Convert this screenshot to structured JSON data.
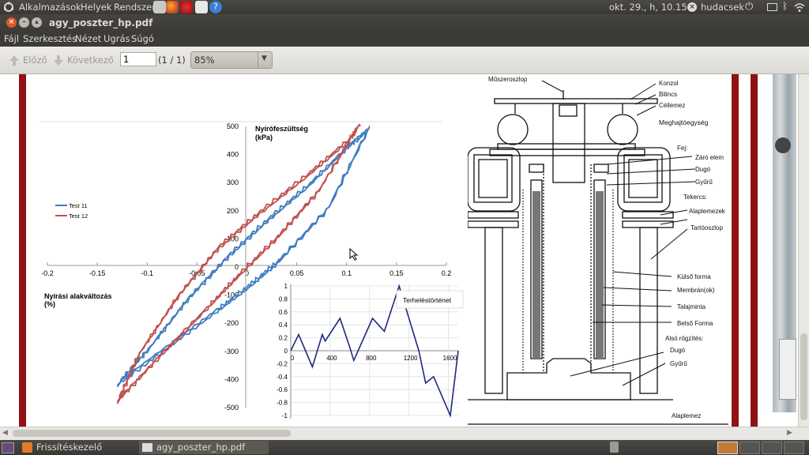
{
  "top_panel": {
    "menu_applications": "Alkalmazások",
    "menu_places": "Helyek",
    "menu_system": "Rendszer",
    "clock": "okt. 29., h, 10.15",
    "user": "hudacsek"
  },
  "window": {
    "title": "agy_poszter_hp.pdf"
  },
  "menubar": {
    "file": "Fájl",
    "edit": "Szerkesztés",
    "view": "Nézet",
    "go": "Ugrás",
    "help": "Súgó"
  },
  "toolbar": {
    "prev_label": "Előző",
    "next_label": "Következő",
    "page_value": "1",
    "page_count": "(1 / 1)",
    "zoom_value": "85%"
  },
  "document": {
    "hyst_ylabel_1": "Nyírófeszültség",
    "hyst_ylabel_2": "(kPa)",
    "hyst_xlabel_1": "Nyírási alakváltozás",
    "hyst_xlabel_2": "(%)",
    "legend_1": "Test 11",
    "legend_2": "Test 12",
    "hyst_yticks": [
      "500",
      "400",
      "300",
      "200",
      "100",
      "0",
      "-100",
      "-200",
      "-300",
      "-400",
      "-500"
    ],
    "hyst_xticks": [
      "-0.2",
      "-0.15",
      "-0.1",
      "-0.05",
      "0",
      "0.05",
      "0.1",
      "0.15",
      "0.2"
    ],
    "load_title": "Terheléstörténet",
    "load_yticks": [
      "1",
      "0.8",
      "0.6",
      "0.4",
      "0.2",
      "0",
      "-0.2",
      "-0.4",
      "-0.6",
      "-0.8",
      "-1"
    ],
    "load_xticks": [
      "0",
      "400",
      "800",
      "1200",
      "1600"
    ],
    "diagram_labels": {
      "muszeroszlop": "Műszeroszlop",
      "konzol": "Konzol",
      "bilincs": "Bilincs",
      "cellemez": "Céllemez",
      "meghajto": "Meghajtóegység",
      "fej": "Fej:",
      "zaro": "Záró elem",
      "dugo": "Dugó",
      "gyuru": "Gyűrű",
      "tekercs": "Tekercs:",
      "alaplemezek": "Alaplemezek",
      "tartooszlop": "Tartóoszlop",
      "kulso": "Külső forma",
      "membran": "Membrán(ok)",
      "talaj": "Talajminta",
      "belso": "Belső Forma",
      "also": "Alsó rögzítés:",
      "dugo2": "Dugó",
      "gyuru2": "Gyűrű",
      "alaplemez": "Alaplemez"
    }
  },
  "bottom_panel": {
    "task_1": "Frissítéskezelő",
    "task_2": "agy_poszter_hp.pdf"
  },
  "chart_data": [
    {
      "type": "line",
      "title": "",
      "xlabel": "Nyírási alakváltozás (%)",
      "ylabel": "Nyírófeszültség (kPa)",
      "xlim": [
        -0.2,
        0.2
      ],
      "ylim": [
        -500,
        500
      ],
      "series": [
        {
          "name": "Test 11",
          "color": "#3f7cc0",
          "x": [
            -0.13,
            -0.08,
            -0.03,
            0.0,
            0.03,
            0.08,
            0.12,
            0.1,
            0.06,
            0.02,
            -0.02,
            -0.06,
            -0.1,
            -0.13
          ],
          "y": [
            -420,
            -290,
            -160,
            -80,
            10,
            200,
            480,
            420,
            280,
            160,
            30,
            -120,
            -300,
            -420
          ]
        },
        {
          "name": "Test 12",
          "color": "#c0504d",
          "x": [
            -0.13,
            -0.09,
            -0.04,
            -0.01,
            0.03,
            0.07,
            0.11,
            0.1,
            0.06,
            0.01,
            -0.03,
            -0.07,
            -0.11,
            -0.13
          ],
          "y": [
            -480,
            -330,
            -150,
            -40,
            100,
            260,
            490,
            440,
            320,
            180,
            60,
            -110,
            -320,
            -480
          ]
        }
      ]
    },
    {
      "type": "line",
      "title": "Terheléstörténet",
      "xlim": [
        0,
        1700
      ],
      "ylim": [
        -1,
        1
      ],
      "series": [
        {
          "name": "",
          "color": "#1f2a80",
          "x": [
            0,
            80,
            220,
            320,
            350,
            500,
            600,
            640,
            830,
            950,
            1100,
            1300,
            1370,
            1450,
            1620,
            1700
          ],
          "y": [
            0,
            0.25,
            -0.25,
            0.25,
            0.15,
            0.5,
            0.05,
            -0.15,
            0.5,
            0.3,
            1.0,
            0.0,
            -0.5,
            -0.4,
            -1.0,
            0.0
          ]
        }
      ]
    }
  ]
}
